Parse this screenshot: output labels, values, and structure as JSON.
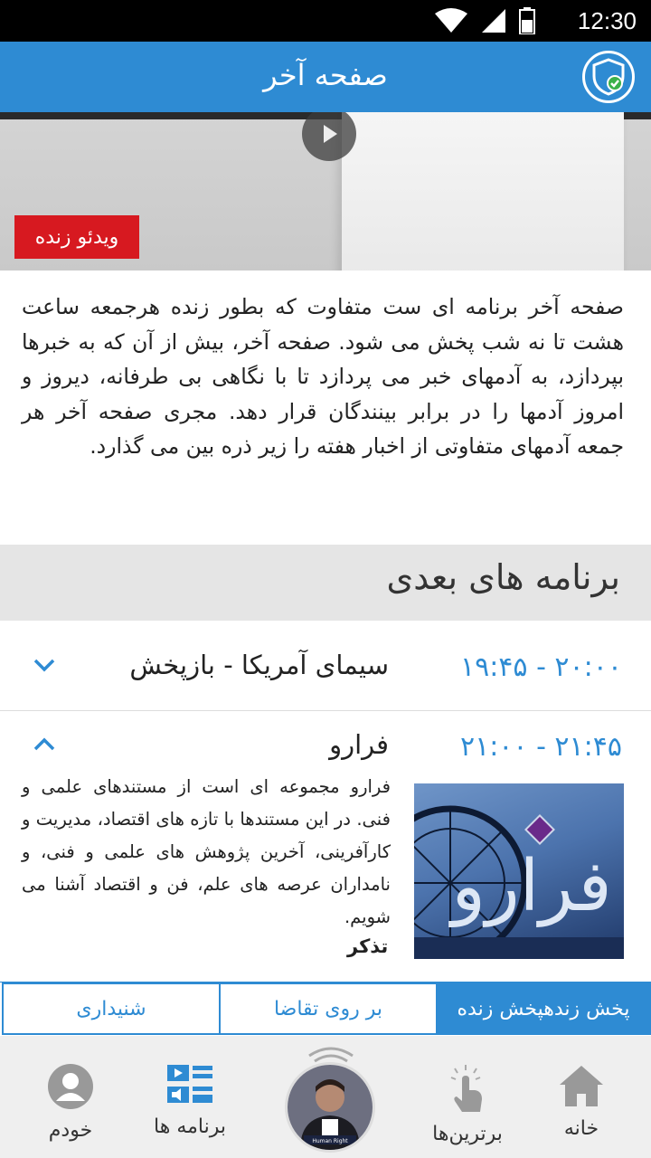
{
  "status_bar": {
    "time": "12:30"
  },
  "header": {
    "title": "صفحه آخر"
  },
  "hero": {
    "live_badge": "ویدئو زنده"
  },
  "description": "صفحه آخر برنامه ای ست متفاوت که بطور زنده هرجمعه ساعت هشت تا نه شب پخش می شود. صفحه آخر، بیش از آن که به خبرها بپردازد، به آدمهای خبر می پردازد تا با نگاهی بی طرفانه، دیروز و امروز آدمها را در برابر بینندگان قرار دهد. مجری صفحه آخر هر جمعه آدمهای متفاوتی از اخبار هفته را زیر ذره بین می گذارد.",
  "next_programs": {
    "title": "برنامه های بعدی",
    "items": [
      {
        "time": "۱۹:۴۵ - ۲۰:۰۰",
        "name": "سیمای آمریکا - بازپخش",
        "expanded": false
      },
      {
        "time": "۲۱:۰۰ - ۲۱:۴۵",
        "name": "فرارو",
        "expanded": true,
        "description": "فرارو مجموعه ای است از مستندهای علمی و فنی. در این مستندها با تازه های اقتصاد، مدیریت و کارآفرینی، آخرین پژوهش های علمی و فنی، و نامداران عرصه های علم، فن و اقتصاد آشنا می شویم.",
        "reminder": "تذکر",
        "thumb_text": "فرارو"
      }
    ]
  },
  "tabs": [
    {
      "label": "شنیداری"
    },
    {
      "label": "بر روی تقاضا"
    },
    {
      "label": "پخش زندهپخش زنده"
    }
  ],
  "bottom_nav": [
    {
      "label": "خودم",
      "icon": "profile-icon"
    },
    {
      "label": "برنامه ها",
      "icon": "programs-icon"
    },
    {
      "label": "برترین‌ها",
      "icon": "top-touch-icon"
    },
    {
      "label": "خانه",
      "icon": "home-icon"
    }
  ],
  "center_logo_text": "Human Right",
  "colors": {
    "accent": "#2e8bd3",
    "live": "#d71920"
  }
}
